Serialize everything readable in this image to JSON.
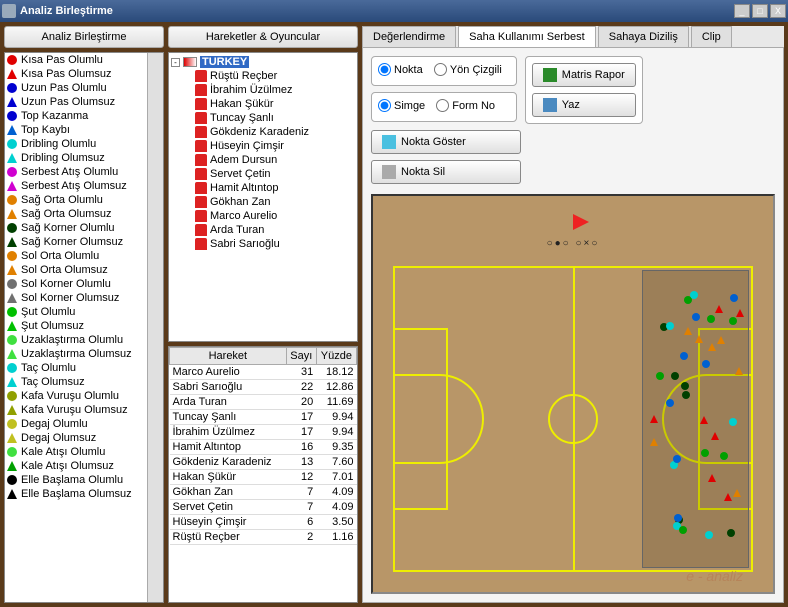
{
  "window": {
    "title": "Analiz Birleştirme"
  },
  "col1": {
    "header": "Analiz Birleştirme",
    "items": [
      {
        "t": "Kısa Pas Olumlu",
        "s": "c",
        "c": "#e00000"
      },
      {
        "t": "Kısa Pas Olumsuz",
        "s": "t",
        "c": "#e00000"
      },
      {
        "t": "Uzun Pas Olumlu",
        "s": "c",
        "c": "#0000d0"
      },
      {
        "t": "Uzun Pas Olumsuz",
        "s": "t",
        "c": "#0000d0"
      },
      {
        "t": "Top Kazanma",
        "s": "c",
        "c": "#0000d0"
      },
      {
        "t": "Top Kaybı",
        "s": "t",
        "c": "#0060d0"
      },
      {
        "t": "Dribling Olumlu",
        "s": "c",
        "c": "#00d0d0"
      },
      {
        "t": "Dribling Olumsuz",
        "s": "t",
        "c": "#00d0d0"
      },
      {
        "t": "Serbest Atış Olumlu",
        "s": "c",
        "c": "#d000d0"
      },
      {
        "t": "Serbest Atış Olumsuz",
        "s": "t",
        "c": "#d000d0"
      },
      {
        "t": "Sağ Orta Olumlu",
        "s": "c",
        "c": "#e08000"
      },
      {
        "t": "Sağ Orta Olumsuz",
        "s": "t",
        "c": "#e08000"
      },
      {
        "t": "Sağ Korner Olumlu",
        "s": "c",
        "c": "#004000"
      },
      {
        "t": "Sağ Korner Olumsuz",
        "s": "t",
        "c": "#004000"
      },
      {
        "t": "Sol Orta Olumlu",
        "s": "c",
        "c": "#e08000"
      },
      {
        "t": "Sol Orta Olumsuz",
        "s": "t",
        "c": "#e08000"
      },
      {
        "t": "Sol Korner Olumlu",
        "s": "c",
        "c": "#707070"
      },
      {
        "t": "Sol Korner Olumsuz",
        "s": "t",
        "c": "#707070"
      },
      {
        "t": "Şut Olumlu",
        "s": "c",
        "c": "#00c000"
      },
      {
        "t": "Şut Olumsuz",
        "s": "t",
        "c": "#00c000"
      },
      {
        "t": "Uzaklaştırma Olumlu",
        "s": "c",
        "c": "#40e040"
      },
      {
        "t": "Uzaklaştırma Olumsuz",
        "s": "t",
        "c": "#40e040"
      },
      {
        "t": "Taç Olumlu",
        "s": "c",
        "c": "#00d0d0"
      },
      {
        "t": "Taç Olumsuz",
        "s": "t",
        "c": "#00d0d0"
      },
      {
        "t": "Kafa Vuruşu Olumlu",
        "s": "c",
        "c": "#90a000"
      },
      {
        "t": "Kafa Vuruşu Olumsuz",
        "s": "t",
        "c": "#90a000"
      },
      {
        "t": "Degaj Olumlu",
        "s": "c",
        "c": "#c0c020"
      },
      {
        "t": "Degaj Olumsuz",
        "s": "t",
        "c": "#c0c020"
      },
      {
        "t": "Kale Atışı Olumlu",
        "s": "c",
        "c": "#40e040"
      },
      {
        "t": "Kale Atışı Olumsuz",
        "s": "t",
        "c": "#00a000"
      },
      {
        "t": "Elle Başlama Olumlu",
        "s": "c",
        "c": "#000000"
      },
      {
        "t": "Elle Başlama Olumsuz",
        "s": "t",
        "c": "#000000"
      }
    ]
  },
  "col2": {
    "header": "Hareketler & Oyuncular",
    "country": "TURKEY",
    "players": [
      "Rüştü Reçber",
      "İbrahim Üzülmez",
      "Hakan Şükür",
      "Tuncay Şanlı",
      "Gökdeniz Karadeniz",
      "Hüseyin Çimşir",
      "Adem Dursun",
      "Servet Çetin",
      "Hamit Altıntop",
      "Gökhan Zan",
      "Marco Aurelio",
      "Arda Turan",
      "Sabri Sarıoğlu"
    ],
    "table": {
      "cols": [
        "Hareket",
        "Sayı",
        "Yüzde"
      ],
      "rows": [
        [
          "Marco Aurelio",
          "31",
          "18.12"
        ],
        [
          "Sabri Sarıoğlu",
          "22",
          "12.86"
        ],
        [
          "Arda Turan",
          "20",
          "11.69"
        ],
        [
          "Tuncay Şanlı",
          "17",
          "9.94"
        ],
        [
          "İbrahim Üzülmez",
          "17",
          "9.94"
        ],
        [
          "Hamit Altıntop",
          "16",
          "9.35"
        ],
        [
          "Gökdeniz Karadeniz",
          "13",
          "7.60"
        ],
        [
          "Hakan Şükür",
          "12",
          "7.01"
        ],
        [
          "Gökhan Zan",
          "7",
          "4.09"
        ],
        [
          "Servet Çetin",
          "7",
          "4.09"
        ],
        [
          "Hüseyin Çimşir",
          "6",
          "3.50"
        ],
        [
          "Rüştü Reçber",
          "2",
          "1.16"
        ]
      ]
    }
  },
  "tabs": [
    "Değerlendirme",
    "Saha Kullanımı Serbest",
    "Sahaya Diziliş",
    "Clip"
  ],
  "activeTab": 1,
  "radios": {
    "r1a": "Nokta",
    "r1b": "Yön Çizgili",
    "r2a": "Simge",
    "r2b": "Form No"
  },
  "buttons": {
    "matris": "Matris Rapor",
    "yaz": "Yaz",
    "goster": "Nokta Göster",
    "sil": "Nokta Sil"
  },
  "logo": "e - analiz",
  "dots": "○●○  ○×○"
}
